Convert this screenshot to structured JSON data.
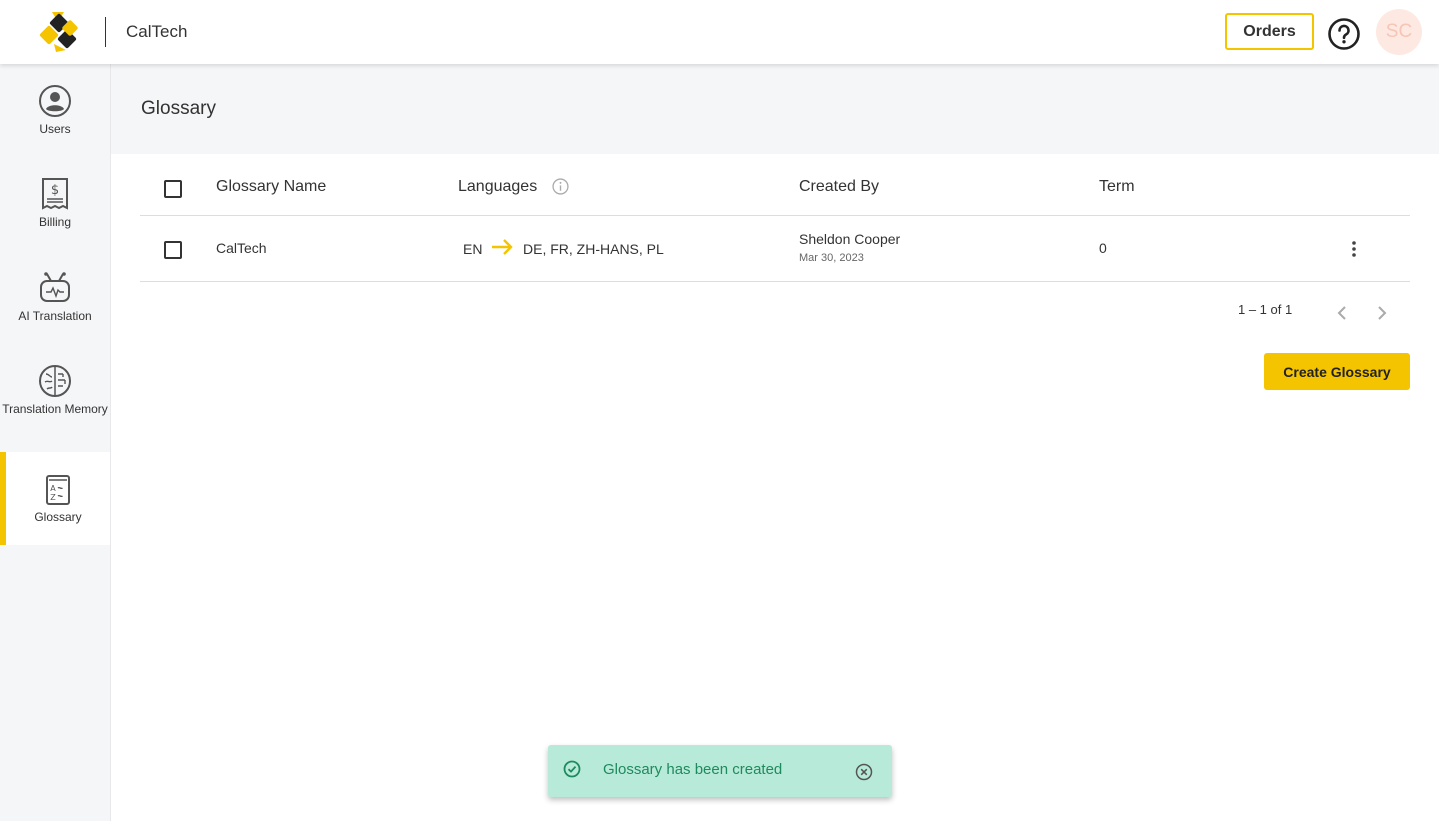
{
  "header": {
    "org_name": "CalTech",
    "orders_label": "Orders",
    "avatar_initials": "SC"
  },
  "sidebar": {
    "items": [
      {
        "label": "Users",
        "icon": "user-circle-icon"
      },
      {
        "label": "Billing",
        "icon": "receipt-dollar-icon"
      },
      {
        "label": "AI Translation",
        "icon": "robot-icon"
      },
      {
        "label": "Translation Memory",
        "icon": "brain-icon"
      },
      {
        "label": "Glossary",
        "icon": "glossary-book-icon",
        "active": true
      }
    ]
  },
  "main": {
    "title": "Glossary",
    "table": {
      "columns": [
        "Glossary Name",
        "Languages",
        "Created By",
        "Term"
      ],
      "rows": [
        {
          "name": "CalTech",
          "source_lang": "EN",
          "target_langs": "DE, FR, ZH-HANS, PL",
          "created_by": "Sheldon Cooper",
          "created_on": "Mar 30, 2023",
          "term": "0"
        }
      ]
    },
    "pagination": {
      "range_text": "1 – 1 of 1"
    },
    "create_button_label": "Create Glossary"
  },
  "toast": {
    "message": "Glossary has been created"
  },
  "colors": {
    "accent": "#f5c400",
    "toast_bg": "#b8ead9",
    "toast_text": "#1f8a5e"
  }
}
